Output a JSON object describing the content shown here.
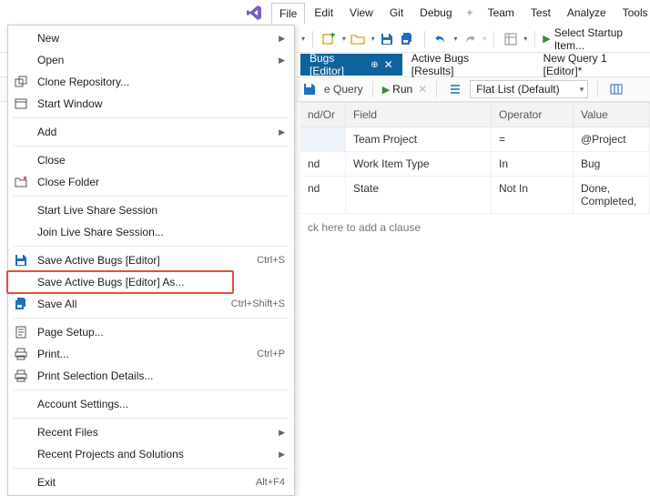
{
  "menubar": {
    "items": [
      "File",
      "Edit",
      "View",
      "Git",
      "Debug",
      "Team",
      "Test",
      "Analyze",
      "Tools"
    ]
  },
  "toolbar": {
    "startup_label": "Select Startup Item..."
  },
  "tabs": [
    {
      "label": "Bugs [Editor]",
      "active": true,
      "pinned": true,
      "closable": true
    },
    {
      "label": "Active Bugs [Results]",
      "active": false
    },
    {
      "label": "New Query 1 [Editor]*",
      "active": false
    }
  ],
  "querybar": {
    "query_label": "e Query",
    "run_label": "Run",
    "flat_icon": "list",
    "flat_label": "Flat List (Default)"
  },
  "grid": {
    "headers": [
      "nd/Or",
      "Field",
      "Operator",
      "Value"
    ],
    "rows": [
      {
        "andor": "",
        "field": "Team Project",
        "op": "=",
        "val": "@Project"
      },
      {
        "andor": "nd",
        "field": "Work Item Type",
        "op": "In",
        "val": "Bug"
      },
      {
        "andor": "nd",
        "field": "State",
        "op": "Not In",
        "val": "Done, Completed,"
      }
    ],
    "add_clause": "ck here to add a clause"
  },
  "filemenu": {
    "items": [
      {
        "label": "New",
        "sub": true
      },
      {
        "label": "Open",
        "sub": true
      },
      {
        "label": "Clone Repository...",
        "icon": "clone"
      },
      {
        "label": "Start Window",
        "icon": "window"
      },
      {
        "sep": true
      },
      {
        "label": "Add",
        "sub": true
      },
      {
        "sep": true
      },
      {
        "label": "Close"
      },
      {
        "label": "Close Folder",
        "icon": "closefolder"
      },
      {
        "sep": true
      },
      {
        "label": "Start Live Share Session"
      },
      {
        "label": "Join Live Share Session..."
      },
      {
        "sep": true
      },
      {
        "label": "Save Active Bugs [Editor]",
        "shortcut": "Ctrl+S",
        "icon": "save"
      },
      {
        "label": "Save Active Bugs [Editor] As...",
        "highlight": true
      },
      {
        "label": "Save All",
        "shortcut": "Ctrl+Shift+S",
        "icon": "saveall"
      },
      {
        "sep": true
      },
      {
        "label": "Page Setup...",
        "icon": "pagesetup"
      },
      {
        "label": "Print...",
        "shortcut": "Ctrl+P",
        "icon": "print"
      },
      {
        "label": "Print Selection Details...",
        "icon": "print"
      },
      {
        "sep": true
      },
      {
        "label": "Account Settings..."
      },
      {
        "sep": true
      },
      {
        "label": "Recent Files",
        "sub": true
      },
      {
        "label": "Recent Projects and Solutions",
        "sub": true
      },
      {
        "sep": true
      },
      {
        "label": "Exit",
        "shortcut": "Alt+F4"
      }
    ]
  }
}
